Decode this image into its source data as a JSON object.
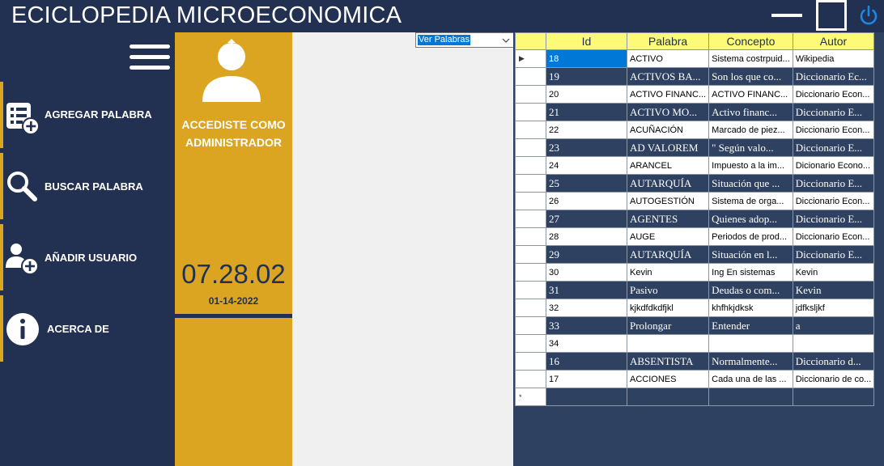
{
  "app": {
    "title": "ECICLOPEDIA MICROECONOMICA"
  },
  "window_controls": {
    "minimize_icon": "minimize-bar",
    "maximize_icon": "square",
    "power_icon": "power-symbol"
  },
  "sidebar": {
    "menu_icon": "hamburger",
    "items": [
      {
        "label": "AGREGAR PALABRA",
        "icon": "list-add-icon"
      },
      {
        "label": "BUSCAR PALABRA",
        "icon": "magnifier-icon"
      },
      {
        "label": "AÑADIR USUARIO",
        "icon": "user-add-icon"
      },
      {
        "label": "ACERCA DE",
        "icon": "info-icon"
      }
    ]
  },
  "user_panel": {
    "avatar_icon": "user-silhouette",
    "status_line1": "ACCEDISTE COMO",
    "status_line2": "ADMINISTRADOR",
    "clock": "07.28.02",
    "date": "01-14-2022"
  },
  "view_select": {
    "selected": "Ver Palabras"
  },
  "grid": {
    "columns": [
      "Id",
      "Palabra",
      "Concepto",
      "Autor"
    ],
    "rows": [
      {
        "id": "18",
        "palabra": "ACTIVO",
        "concepto": "Sistema costrpuid...",
        "autor": "Wikipedia",
        "style": "light",
        "selected": true
      },
      {
        "id": "19",
        "palabra": "ACTIVOS BA...",
        "concepto": "Son los que co...",
        "autor": "Diccionario Ec...",
        "style": "dark"
      },
      {
        "id": "20",
        "palabra": "ACTIVO FINANC...",
        "concepto": "ACTIVO FINANC...",
        "autor": "Diccionario Econ...",
        "style": "light"
      },
      {
        "id": "21",
        "palabra": "ACTIVO MO...",
        "concepto": " Activo financ...",
        "autor": "Diccionario E...",
        "style": "dark"
      },
      {
        "id": "22",
        "palabra": "ACUÑACIÓN",
        "concepto": "Marcado de piez...",
        "autor": "Diccionario Econ...",
        "style": "light"
      },
      {
        "id": "23",
        "palabra": "AD VALOREM",
        "concepto": " \" Según valo...",
        "autor": "Diccionario E...",
        "style": "dark"
      },
      {
        "id": "24",
        "palabra": "ARANCEL",
        "concepto": " Impuesto a la im...",
        "autor": "Dicionario Econo...",
        "style": "light"
      },
      {
        "id": "25",
        "palabra": "AUTARQUÍA",
        "concepto": "Situación que ...",
        "autor": "Diccionario E...",
        "style": "dark"
      },
      {
        "id": "26",
        "palabra": "AUTOGESTIÓN",
        "concepto": " Sistema de orga...",
        "autor": "Diccionario Econ...",
        "style": "light"
      },
      {
        "id": "27",
        "palabra": "AGENTES",
        "concepto": "Quienes adop...",
        "autor": "Diccionario E...",
        "style": "dark"
      },
      {
        "id": "28",
        "palabra": "AUGE",
        "concepto": "Periodos de prod...",
        "autor": "Diccionario Econ...",
        "style": "light"
      },
      {
        "id": "29",
        "palabra": "AUTARQUÍA",
        "concepto": "Situación en l...",
        "autor": "Diccionario E...",
        "style": "dark"
      },
      {
        "id": "30",
        "palabra": "Kevin",
        "concepto": "Ing En sistemas",
        "autor": "Kevin",
        "style": "light"
      },
      {
        "id": "31",
        "palabra": "Pasivo",
        "concepto": "Deudas o com...",
        "autor": "Kevin",
        "style": "dark"
      },
      {
        "id": "32",
        "palabra": "kjkdfdkdfjkl",
        "concepto": "khfhkjdksk",
        "autor": "jdfksljkf",
        "style": "light"
      },
      {
        "id": "33",
        "palabra": "Prolongar",
        "concepto": "Entender",
        "autor": "a",
        "style": "dark"
      },
      {
        "id": "34",
        "palabra": "",
        "concepto": "",
        "autor": "",
        "style": "light"
      },
      {
        "id": "16",
        "palabra": "ABSENTISTA",
        "concepto": "Normalmente...",
        "autor": "Diccionario d...",
        "style": "dark"
      },
      {
        "id": "17",
        "palabra": "ACCIONES",
        "concepto": "Cada una de las ...",
        "autor": "Diccionario de co...",
        "style": "light"
      }
    ],
    "current_row_marker": "▶",
    "new_row_marker": "*"
  },
  "colors": {
    "navy": "#223051",
    "gold": "#dba521",
    "grid_header": "#fdfa7a",
    "grid_dark_row": "#2e4160",
    "selection": "#0078d7",
    "power": "#1e88e5"
  }
}
